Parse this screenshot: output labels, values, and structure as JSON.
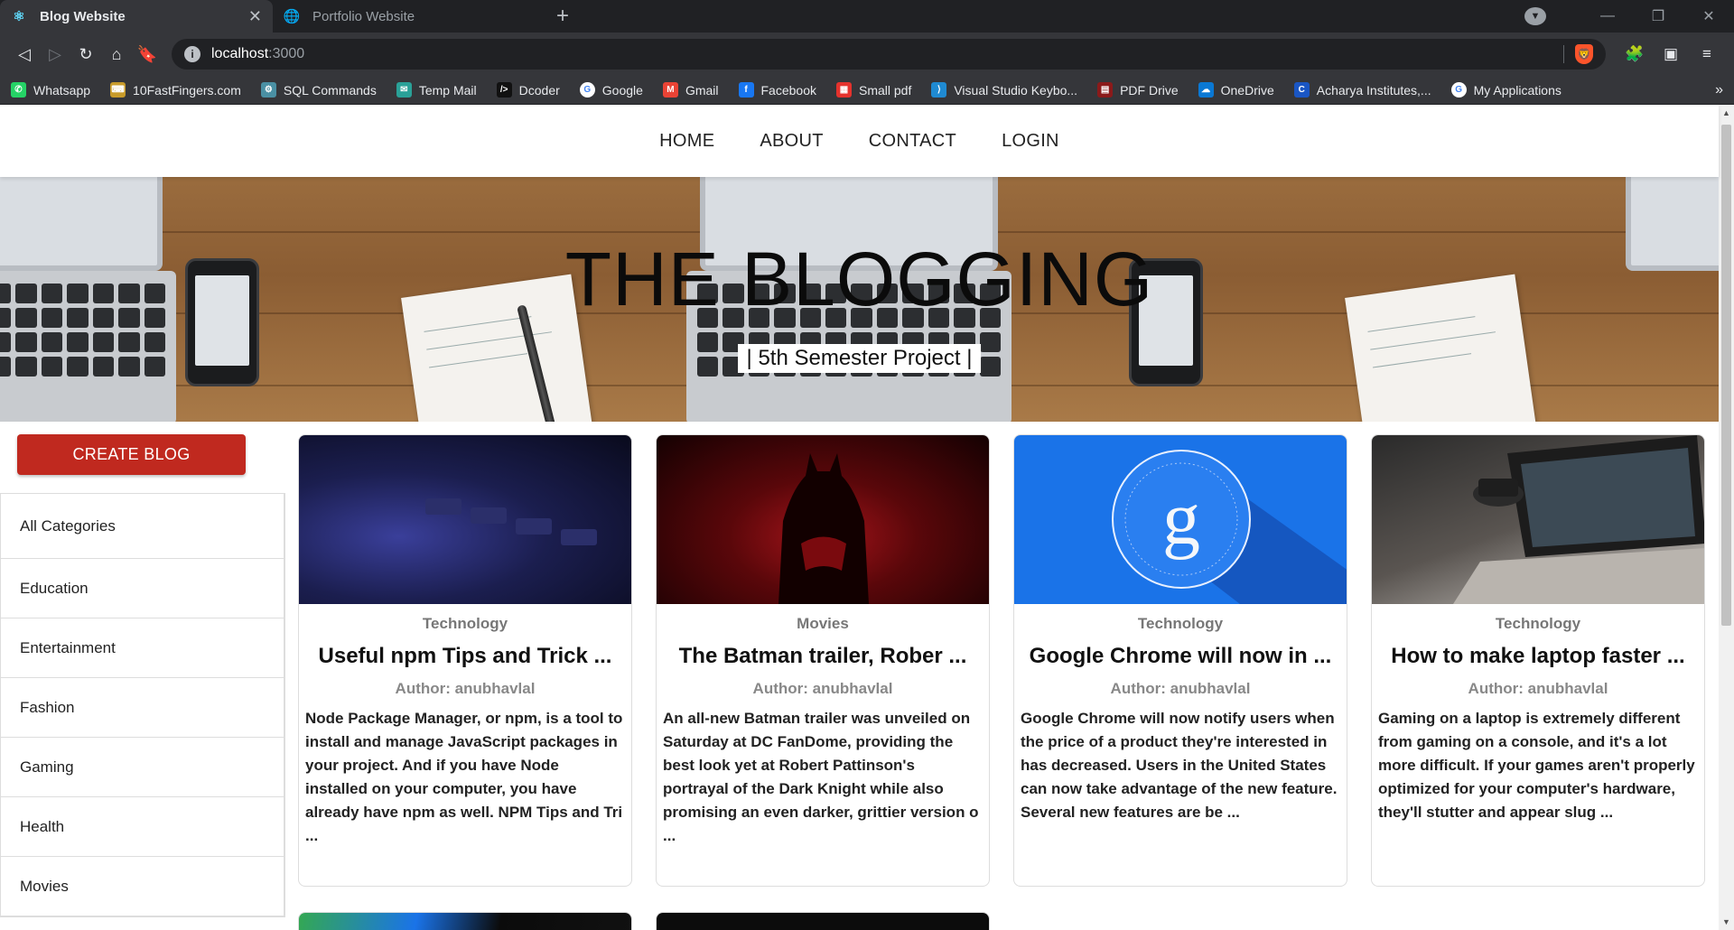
{
  "browser": {
    "tabs": [
      {
        "title": "Blog Website",
        "active": true
      },
      {
        "title": "Portfolio Website",
        "active": false
      }
    ],
    "url_host": "localhost",
    "url_port": ":3000",
    "bookmarks": [
      {
        "label": "Whatsapp",
        "icon": "whatsapp-icon",
        "color": "#25d366"
      },
      {
        "label": "10FastFingers.com",
        "icon": "fastfingers-icon",
        "color": "#c89b2a"
      },
      {
        "label": "SQL Commands",
        "icon": "sql-icon",
        "color": "#4a90a4"
      },
      {
        "label": "Temp Mail",
        "icon": "tempmail-icon",
        "color": "#2aa198"
      },
      {
        "label": "Dcoder",
        "icon": "dcoder-icon",
        "color": "#111111"
      },
      {
        "label": "Google",
        "icon": "google-icon",
        "color": "#ffffff"
      },
      {
        "label": "Gmail",
        "icon": "gmail-icon",
        "color": "#ea4335"
      },
      {
        "label": "Facebook",
        "icon": "facebook-icon",
        "color": "#1877f2"
      },
      {
        "label": "Small pdf",
        "icon": "smallpdf-icon",
        "color": "#e5322d"
      },
      {
        "label": "Visual Studio Keybo...",
        "icon": "vscode-icon",
        "color": "#1f8ad2"
      },
      {
        "label": "PDF Drive",
        "icon": "pdfdrive-icon",
        "color": "#8b1a1a"
      },
      {
        "label": "OneDrive",
        "icon": "onedrive-icon",
        "color": "#0a78d4"
      },
      {
        "label": "Acharya Institutes,...",
        "icon": "acharya-icon",
        "color": "#1a56c4"
      },
      {
        "label": "My Applications",
        "icon": "google-icon",
        "color": "#ffffff"
      }
    ],
    "more_bookmarks": "»"
  },
  "nav": {
    "items": [
      "HOME",
      "ABOUT",
      "CONTACT",
      "LOGIN"
    ]
  },
  "hero": {
    "title": "THE BLOGGING",
    "subtitle": "| 5th Semester Project |"
  },
  "sidebar": {
    "create_button": "CREATE BLOG",
    "categories": [
      "All Categories",
      "Education",
      "Entertainment",
      "Fashion",
      "Gaming",
      "Health",
      "Movies"
    ]
  },
  "posts": [
    {
      "category": "Technology",
      "title": "Useful npm Tips and Trick ...",
      "author": "Author: anubhavlal",
      "description": "Node Package Manager, or npm, is a tool to install and manage JavaScript packages in your project. And if you have Node installed on your computer, you have already have npm as well. NPM Tips and Tri ...",
      "image": "keyboard-photo"
    },
    {
      "category": "Movies",
      "title": "The Batman trailer, Rober ...",
      "author": "Author: anubhavlal",
      "description": "An all-new Batman trailer was unveiled on Saturday at DC FanDome, providing the best look yet at Robert Pattinson's portrayal of the Dark Knight while also promising an even darker, grittier version o ...",
      "image": "batman-photo"
    },
    {
      "category": "Technology",
      "title": "Google Chrome will now in ...",
      "author": "Author: anubhavlal",
      "description": "Google Chrome will now notify users when the price of a product they're interested in has decreased. Users in the United States can now take advantage of the new feature. Several new features are be ...",
      "image": "google-logo-photo"
    },
    {
      "category": "Technology",
      "title": "How to make laptop faster ...",
      "author": "Author: anubhavlal",
      "description": "Gaming on a laptop is extremely different from gaming on a console, and it's a lot more difficult. If your games aren't properly optimized for your computer's hardware, they'll stutter and appear slug ...",
      "image": "laptop-coffee-photo"
    }
  ]
}
